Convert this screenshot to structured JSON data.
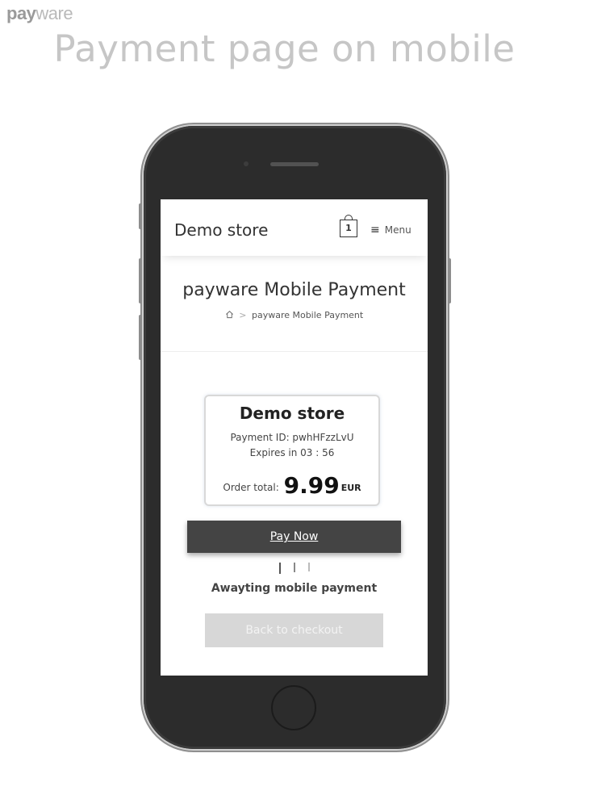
{
  "brand": {
    "part1": "pay",
    "part2": "ware"
  },
  "headline": "Payment page on mobile",
  "screen": {
    "header": {
      "store_name": "Demo store",
      "cart_count": "1",
      "menu_icon": "≡",
      "menu_label": "Menu"
    },
    "page_title": "payware Mobile Payment",
    "breadcrumb": {
      "separator": ">",
      "current": "payware Mobile Payment"
    },
    "card": {
      "store": "Demo store",
      "payment_id": "Payment ID: pwhHFzzLvU",
      "expires": "Expires in 03 : 56",
      "total_label": "Order total:",
      "amount": "9.99",
      "currency": "EUR"
    },
    "pay_button": "Pay Now",
    "status": "Awayting mobile payment",
    "back_button": "Back to checkout"
  },
  "colors": {
    "pay_button": "#444444",
    "back_button": "#d7d7d7",
    "headline": "#c6c6c6"
  }
}
